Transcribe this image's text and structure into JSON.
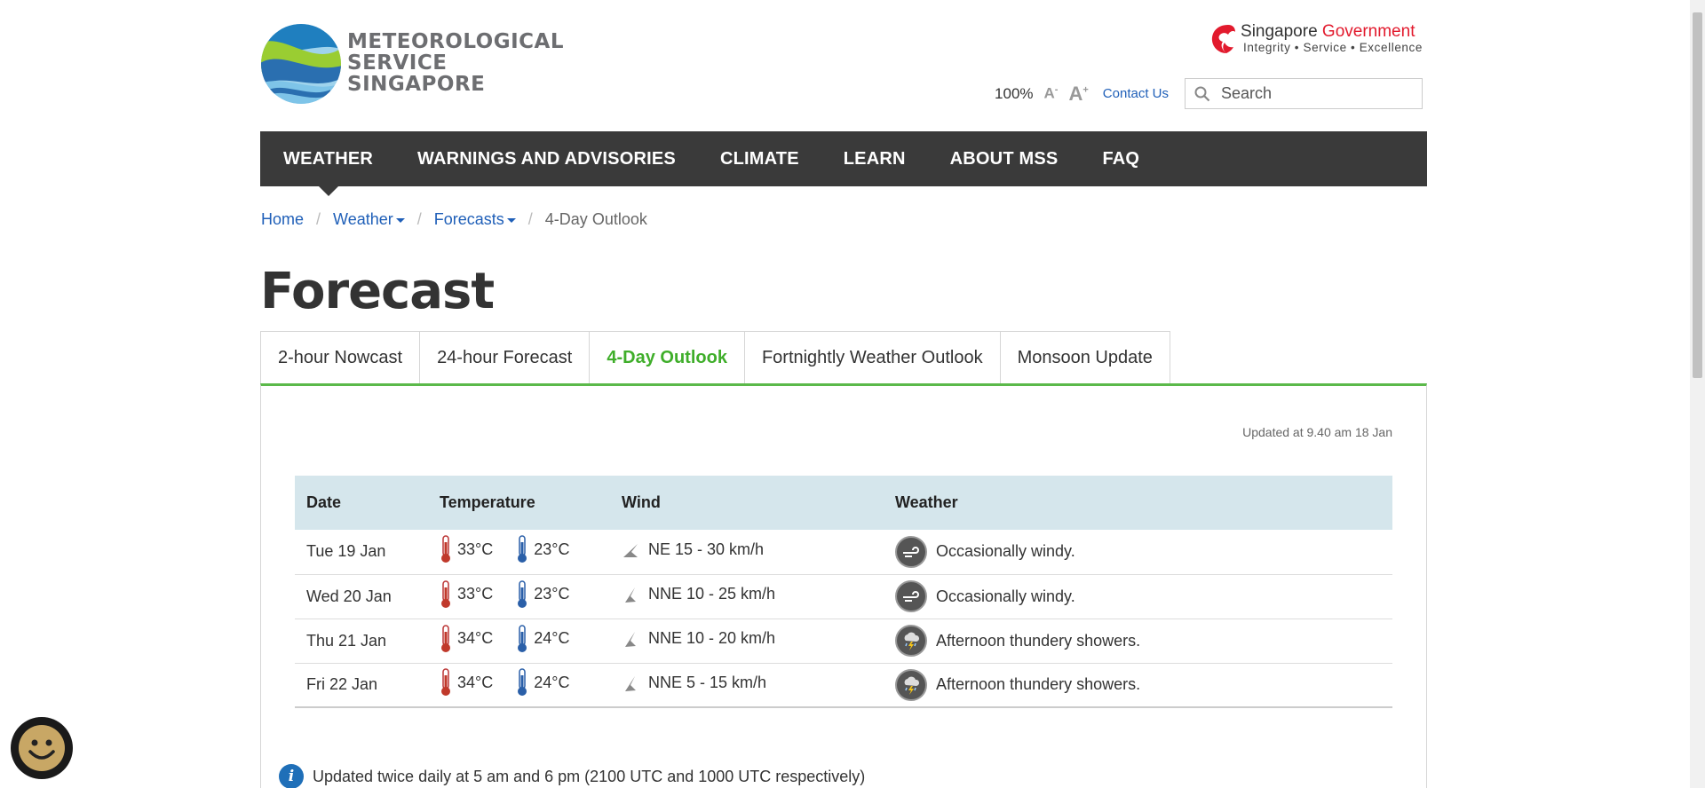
{
  "header": {
    "logo_line1": "Meteorological",
    "logo_line2": "Service",
    "logo_line3": "Singapore",
    "gov_word1": "Singapore",
    "gov_word2": "Government",
    "gov_tagline": "Integrity • Service • Excellence",
    "zoom_level": "100%",
    "font_decrease": "A",
    "font_increase": "A",
    "contact_label": "Contact Us",
    "search_placeholder": "Search"
  },
  "nav": {
    "items": [
      {
        "label": "WEATHER"
      },
      {
        "label": "WARNINGS AND ADVISORIES"
      },
      {
        "label": "CLIMATE"
      },
      {
        "label": "LEARN"
      },
      {
        "label": "ABOUT MSS"
      },
      {
        "label": "FAQ"
      }
    ],
    "active": "WEATHER"
  },
  "breadcrumb": {
    "home": "Home",
    "weather": "Weather",
    "forecasts": "Forecasts",
    "current": "4-Day Outlook"
  },
  "page_title": "Forecast",
  "tabs": [
    {
      "label": "2-hour Nowcast"
    },
    {
      "label": "24-hour Forecast"
    },
    {
      "label": "4-Day Outlook"
    },
    {
      "label": "Fortnightly Weather Outlook"
    },
    {
      "label": "Monsoon Update"
    }
  ],
  "active_tab": "4-Day Outlook",
  "updated_text": "Updated at 9.40 am 18 Jan",
  "table": {
    "headers": [
      "Date",
      "Temperature",
      "Wind",
      "Weather"
    ],
    "rows": [
      {
        "date": "Tue 19 Jan",
        "high": "33°C",
        "low": "23°C",
        "wind": "NE 15 - 30 km/h",
        "weather": "Occasionally windy.",
        "icon": "windy-icon"
      },
      {
        "date": "Wed 20 Jan",
        "high": "33°C",
        "low": "23°C",
        "wind": "NNE 10 - 25 km/h",
        "weather": "Occasionally windy.",
        "icon": "windy-icon"
      },
      {
        "date": "Thu 21 Jan",
        "high": "34°C",
        "low": "24°C",
        "wind": "NNE 10 - 20 km/h",
        "weather": "Afternoon thundery showers.",
        "icon": "thundery-showers-icon"
      },
      {
        "date": "Fri 22 Jan",
        "high": "34°C",
        "low": "24°C",
        "wind": "NNE 5 - 15 km/h",
        "weather": "Afternoon thundery showers.",
        "icon": "thundery-showers-icon"
      }
    ]
  },
  "note": "Updated twice daily at 5 am and 6 pm (2100 UTC and 1000 UTC respectively)",
  "colors": {
    "accent_green": "#3fae2a",
    "nav_bg": "#3a3a3a",
    "link_blue": "#1f5fb8",
    "table_header_bg": "#d5e6ec",
    "gov_red": "#e21a2d"
  }
}
